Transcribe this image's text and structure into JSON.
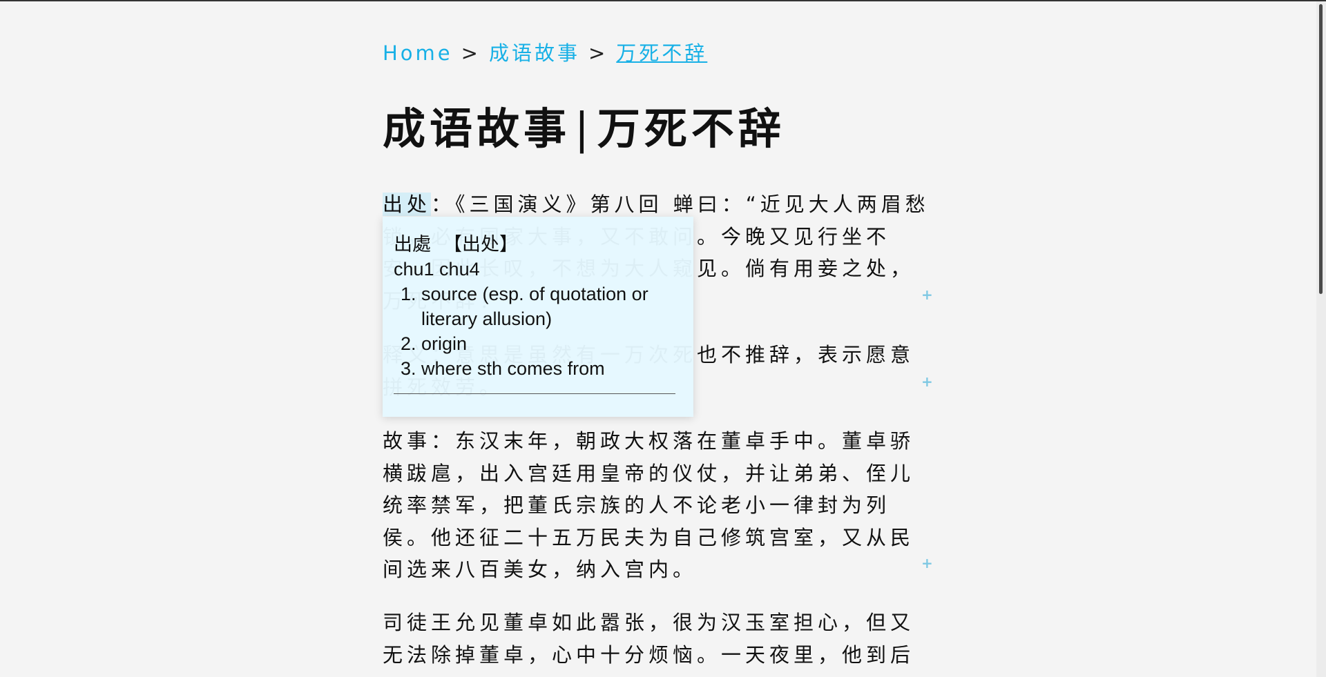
{
  "breadcrumb": {
    "home": "Home",
    "sep": ">",
    "section": "成语故事",
    "current": "万死不辞"
  },
  "page": {
    "title_left": "成语故事",
    "title_sep": "|",
    "title_right": "万死不辞"
  },
  "paragraphs": {
    "p1_highlight": "出处",
    "p1_rest": "：《三国演义》第八回 蝉曰：“近见大人两眉愁锁，必有国家大事，又不敢问。今晚又见行坐不安，因此长叹，不想为大人窥见。倘有用妾之处，万死不辞！”",
    "p2": "释义：意思是虽然有一万次死也不推辞，表示愿意拼死效劳。",
    "p3": "故事：东汉末年，朝政大权落在董卓手中。董卓骄横跋扈，出入宫廷用皇帝的仪仗，并让弟弟、侄儿统率禁军，把董氏宗族的人不论老小一律封为列侯。他还征二十五万民夫为自己修筑宫室，又从民间选来八百美女，纳入宫内。",
    "p4": "司徒王允见董卓如此嚣张，很为汉玉室担心，但又无法除掉董卓，心中十分烦恼。一天夜里，他到后"
  },
  "popup": {
    "traditional": "出處",
    "simplified": "【出处】",
    "pinyin": "chu1 chu4",
    "definitions": [
      "source (esp. of quotation or literary allusion)",
      "origin",
      "where sth comes from"
    ]
  },
  "plus_icon": "+",
  "colors": {
    "link": "#17b0e6",
    "popup_bg": "#e5f8ff",
    "plus": "#7ec8e3"
  }
}
